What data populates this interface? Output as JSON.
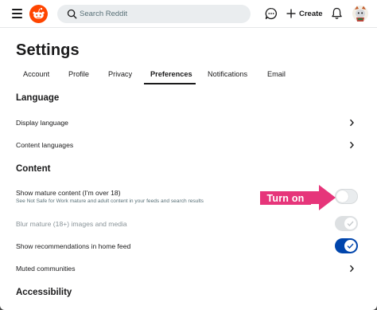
{
  "topbar": {
    "search_placeholder": "Search Reddit",
    "create_label": "Create"
  },
  "page": {
    "title": "Settings"
  },
  "tabs": [
    {
      "label": "Account"
    },
    {
      "label": "Profile"
    },
    {
      "label": "Privacy"
    },
    {
      "label": "Preferences",
      "active": true
    },
    {
      "label": "Notifications"
    },
    {
      "label": "Email"
    }
  ],
  "language": {
    "title": "Language",
    "display_language": "Display language",
    "content_languages": "Content languages"
  },
  "content": {
    "title": "Content",
    "mature_label": "Show mature content (I'm over 18)",
    "mature_sub": "See Not Safe for Work mature and adult content in your feeds and search results",
    "mature_enabled": false,
    "blur_label": "Blur mature (18+) images and media",
    "blur_enabled": true,
    "blur_disabled": true,
    "recommendations_label": "Show recommendations in home feed",
    "recommendations_enabled": true,
    "muted_label": "Muted communities"
  },
  "accessibility": {
    "title": "Accessibility"
  },
  "annotation": {
    "text": "Turn on",
    "color": "#e6357a"
  },
  "colors": {
    "brand": "#ff4500",
    "toggle_on": "#0045ac",
    "text": "#1a1a1b"
  }
}
